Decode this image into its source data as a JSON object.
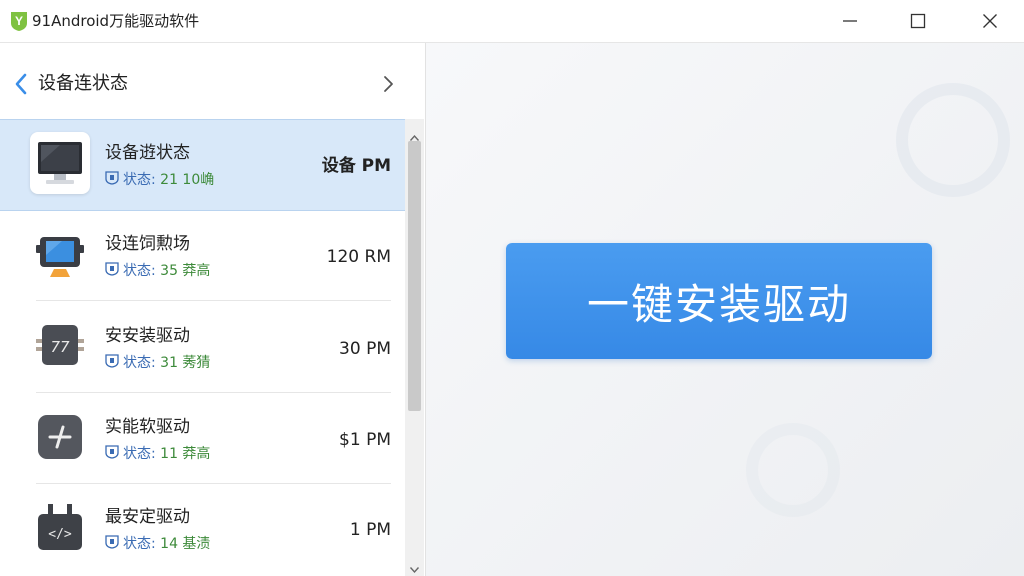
{
  "app": {
    "title": "91Android万能驱动软件",
    "logo_letter": "Y"
  },
  "colors": {
    "accent": "#3a8ee8",
    "selected_bg": "#d8e8f9",
    "sub_green": "#3d8a3a"
  },
  "header": {
    "title": "设备连状态"
  },
  "items": [
    {
      "name": "设备逰状态",
      "sub_label": "状态:",
      "sub_value": "21 10崅",
      "time": "设备 PM",
      "icon": "monitor-icon",
      "selected": true
    },
    {
      "name": "设连饲勲场",
      "sub_label": "状态:",
      "sub_value": "35 莽高",
      "time": "120 RM",
      "icon": "display-device-icon",
      "selected": false
    },
    {
      "name": "安安装驱动",
      "sub_label": "状态:",
      "sub_value": "31 莠猜",
      "time": "30 PM",
      "icon": "chip-77-icon",
      "selected": false
    },
    {
      "name": "实能软驱动",
      "sub_label": "状态:",
      "sub_value": "11 莽高",
      "time": "$1 PM",
      "icon": "slash-minus-icon",
      "selected": false
    },
    {
      "name": "最安定驱动",
      "sub_label": "状态:",
      "sub_value": "14 基渍",
      "time": "1 PM",
      "icon": "code-plug-icon",
      "selected": false
    }
  ],
  "main": {
    "install_button_label": "一键安装驱动"
  }
}
